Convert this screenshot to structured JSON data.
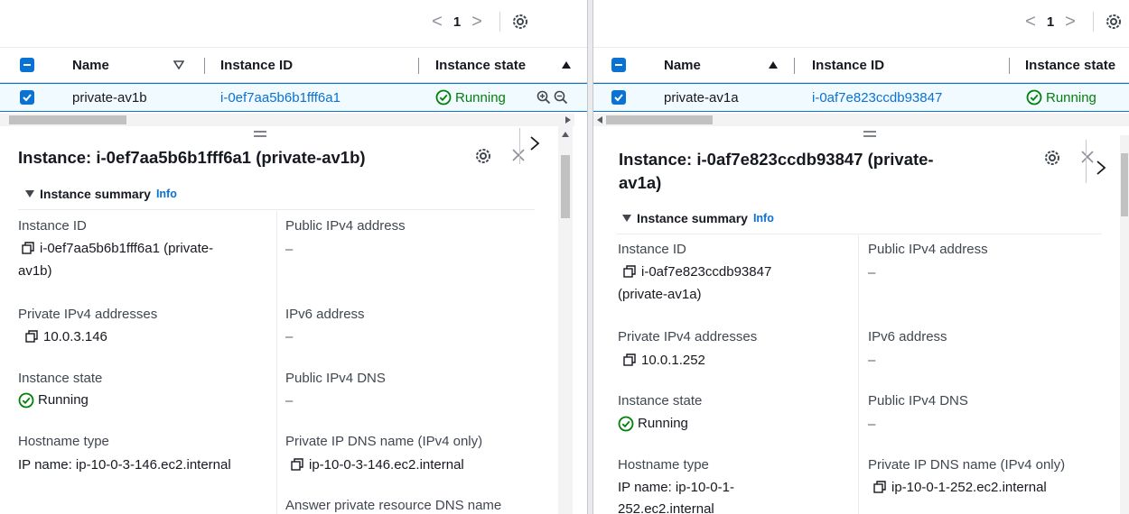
{
  "left": {
    "pager": {
      "prev": "<",
      "page": "1",
      "next": ">"
    },
    "table": {
      "col_name": "Name",
      "col_id": "Instance ID",
      "col_state": "Instance state",
      "row": {
        "name": "private-av1b",
        "id": "i-0ef7aa5b6b1fff6a1",
        "state": "Running"
      }
    },
    "detail": {
      "title": "Instance: i-0ef7aa5b6b1fff6a1 (private-av1b)",
      "summary": "Instance summary",
      "info": "Info",
      "instance_id_label": "Instance ID",
      "instance_id_line1": "i-0ef7aa5b6b1fff6a1 (private-",
      "instance_id_line2": "av1b)",
      "public_ipv4_label": "Public IPv4 address",
      "public_ipv4_value": "–",
      "private_ipv4_label": "Private IPv4 addresses",
      "private_ipv4_value": "10.0.3.146",
      "ipv6_label": "IPv6 address",
      "ipv6_value": "–",
      "state_label": "Instance state",
      "state_value": "Running",
      "public_dns_label": "Public IPv4 DNS",
      "public_dns_value": "–",
      "hostname_label": "Hostname type",
      "hostname_value": "IP name: ip-10-0-3-146.ec2.internal",
      "private_dns_label": "Private IP DNS name (IPv4 only)",
      "private_dns_value": "ip-10-0-3-146.ec2.internal",
      "answer_label": "Answer private resource DNS name"
    }
  },
  "right": {
    "pager": {
      "prev": "<",
      "page": "1",
      "next": ">"
    },
    "table": {
      "col_name": "Name",
      "col_id": "Instance ID",
      "col_state": "Instance state",
      "row": {
        "name": "private-av1a",
        "id": "i-0af7e823ccdb93847",
        "state": "Running"
      }
    },
    "detail": {
      "title_line1": "Instance: i-0af7e823ccdb93847 (private-",
      "title_line2": "av1a)",
      "summary": "Instance summary",
      "info": "Info",
      "instance_id_label": "Instance ID",
      "instance_id_line1": "i-0af7e823ccdb93847",
      "instance_id_line2": "(private-av1a)",
      "public_ipv4_label": "Public IPv4 address",
      "public_ipv4_value": "–",
      "private_ipv4_label": "Private IPv4 addresses",
      "private_ipv4_value": "10.0.1.252",
      "ipv6_label": "IPv6 address",
      "ipv6_value": "–",
      "state_label": "Instance state",
      "state_value": "Running",
      "public_dns_label": "Public IPv4 DNS",
      "public_dns_value": "–",
      "hostname_label": "Hostname type",
      "hostname_line1": "IP name: ip-10-0-1-",
      "hostname_line2": "252.ec2.internal",
      "private_dns_label": "Private IP DNS name (IPv4 only)",
      "private_dns_value": "ip-10-0-1-252.ec2.internal"
    }
  },
  "colors": {
    "link": "#0972d3",
    "success": "#037f0c",
    "selected_bg": "#f1faff"
  },
  "icons": [
    "settings-gear-icon",
    "copy-icon",
    "status-success-icon",
    "zoom-in-icon",
    "zoom-out-icon",
    "close-icon",
    "chevron-right-icon",
    "checkbox-indeterminate-icon",
    "checkbox-checked-icon",
    "sort-triangle-icon",
    "drag-handle-icon"
  ]
}
